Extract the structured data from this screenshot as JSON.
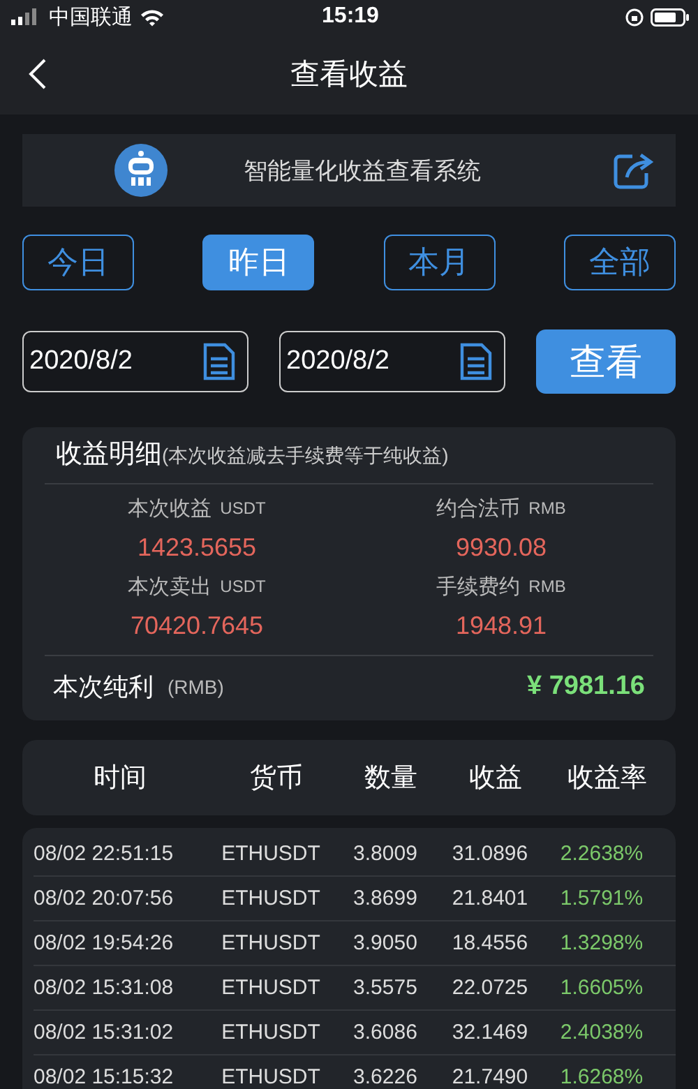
{
  "status_bar": {
    "carrier": "中国联通",
    "time": "15:19"
  },
  "nav": {
    "title": "查看收益"
  },
  "banner": {
    "title": "智能量化收益查看系统"
  },
  "tabs": [
    {
      "label": "今日",
      "selected": false
    },
    {
      "label": "昨日",
      "selected": true
    },
    {
      "label": "本月",
      "selected": false
    },
    {
      "label": "全部",
      "selected": false
    }
  ],
  "date_from": {
    "value": "2020/8/2"
  },
  "date_to": {
    "value": "2020/8/2"
  },
  "view_button": "查看",
  "summary": {
    "title": "收益明细",
    "note": "(本次收益减去手续费等于纯收益)",
    "items": [
      {
        "label": "本次收益",
        "unit": "USDT",
        "value": "1423.5655"
      },
      {
        "label": "约合法币",
        "unit": "RMB",
        "value": "9930.08"
      },
      {
        "label": "本次卖出",
        "unit": "USDT",
        "value": "70420.7645"
      },
      {
        "label": "手续费约",
        "unit": "RMB",
        "value": "1948.91"
      }
    ],
    "net_label": "本次纯利",
    "net_unit": "(RMB)",
    "net_value": "¥ 7981.16"
  },
  "table": {
    "columns": [
      "时间",
      "货币",
      "数量",
      "收益",
      "收益率"
    ],
    "rows": [
      [
        "08/02 22:51:15",
        "ETHUSDT",
        "3.8009",
        "31.0896",
        "2.2638%"
      ],
      [
        "08/02 20:07:56",
        "ETHUSDT",
        "3.8699",
        "21.8401",
        "1.5791%"
      ],
      [
        "08/02 19:54:26",
        "ETHUSDT",
        "3.9050",
        "18.4556",
        "1.3298%"
      ],
      [
        "08/02 15:31:08",
        "ETHUSDT",
        "3.5575",
        "22.0725",
        "1.6605%"
      ],
      [
        "08/02 15:31:02",
        "ETHUSDT",
        "3.6086",
        "32.1469",
        "2.4038%"
      ],
      [
        "08/02 15:15:32",
        "ETHUSDT",
        "3.6226",
        "21.7490",
        "1.6268%"
      ]
    ]
  }
}
